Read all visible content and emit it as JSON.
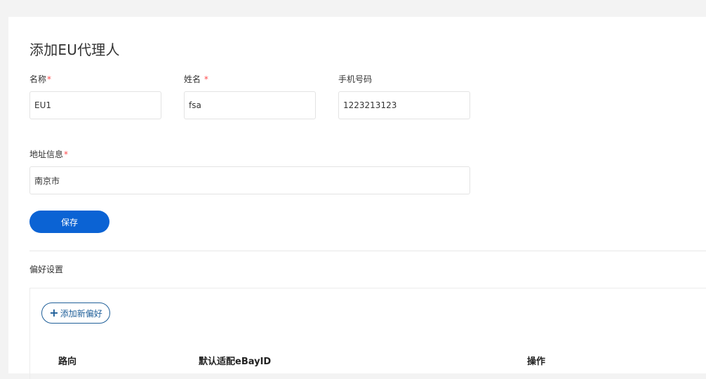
{
  "page": {
    "title": "添加EU代理人"
  },
  "form": {
    "name": {
      "label": "名称",
      "required": "*",
      "value": "EU1"
    },
    "surname": {
      "label": "姓名",
      "required": " *",
      "value": "fsa"
    },
    "phone": {
      "label": "手机号码",
      "value": "1223213123"
    },
    "address": {
      "label": "地址信息",
      "required": "*",
      "value": "南京市"
    },
    "save_label": "保存"
  },
  "preferences": {
    "section_title": "偏好设置",
    "add_button_label": "添加新偏好",
    "add_button_icon": "plus-icon",
    "columns": [
      "路向",
      "默认适配eBayID",
      "操作"
    ]
  },
  "colors": {
    "primary": "#0b63d4",
    "outline_button": "#1f5f99",
    "required": "#ff4d4f",
    "background": "#f3f3f3"
  }
}
